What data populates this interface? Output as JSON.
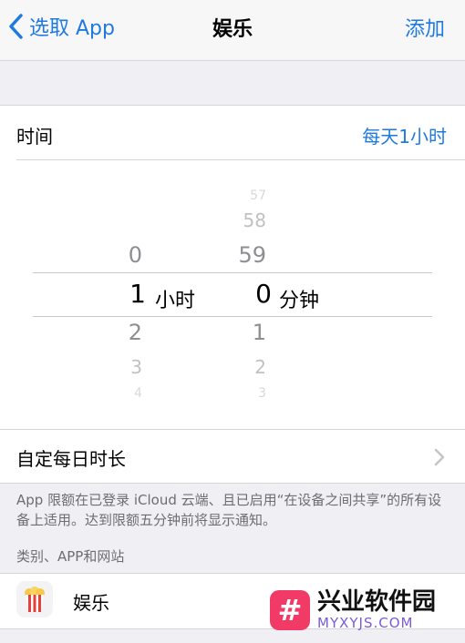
{
  "nav": {
    "back_label": "选取 App",
    "title": "娱乐",
    "add_label": "添加"
  },
  "time": {
    "label": "时间",
    "value": "每天1小时"
  },
  "picker": {
    "hours": {
      "above": "0",
      "selected": "1",
      "below": [
        "2",
        "3",
        "4"
      ],
      "unit": "小时"
    },
    "minutes": {
      "above": [
        "57",
        "58",
        "59"
      ],
      "selected": "0",
      "below": [
        "1",
        "2",
        "3"
      ],
      "unit": "分钟"
    }
  },
  "custom": {
    "label": "自定每日时长"
  },
  "footnote": "App 限额在已登录 iCloud 云端、且已启用“在设备之间共享”的所有设备上适用。达到限额五分钟前将显示通知。",
  "section_header": "类别、APP和网站",
  "app_row": {
    "name": "娱乐",
    "icon": "popcorn-icon"
  },
  "watermark": {
    "line1": "兴业软件园",
    "line2": "MYXYJS.COM"
  },
  "colors": {
    "accent": "#1f7ae0",
    "background": "#efeff4",
    "watermark_brand": "#f23a67"
  }
}
